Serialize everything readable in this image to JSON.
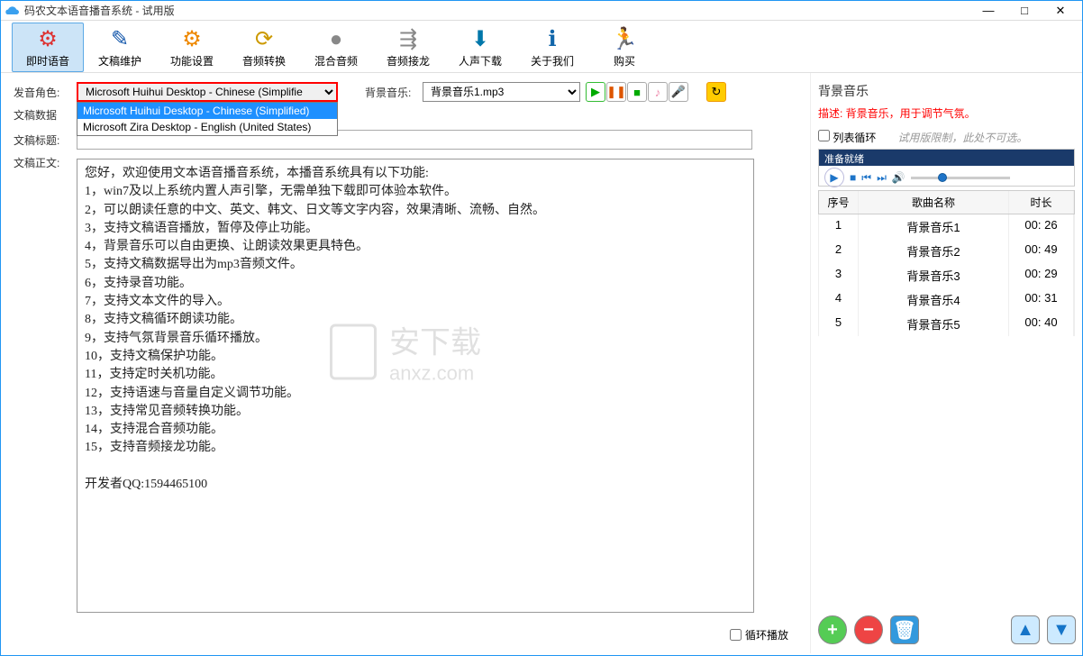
{
  "window": {
    "title": "码农文本语音播音系统 - 试用版"
  },
  "toolbar": {
    "items": [
      {
        "label": "即时语音",
        "icon": "⚙",
        "color": "#d33"
      },
      {
        "label": "文稿维护",
        "icon": "✎",
        "color": "#15a"
      },
      {
        "label": "功能设置",
        "icon": "⚙",
        "color": "#e80"
      },
      {
        "label": "音频转换",
        "icon": "⟳",
        "color": "#c90"
      },
      {
        "label": "混合音频",
        "icon": "●",
        "color": "#888"
      },
      {
        "label": "音频接龙",
        "icon": "⇶",
        "color": "#888"
      },
      {
        "label": "人声下载",
        "icon": "⬇",
        "color": "#07a"
      },
      {
        "label": "关于我们",
        "icon": "ℹ",
        "color": "#16a"
      },
      {
        "label": "购买",
        "icon": "🏃",
        "color": "#07a"
      }
    ]
  },
  "voice": {
    "label": "发音角色:",
    "selected": "Microsoft Huihui Desktop - Chinese (Simplifie",
    "options": [
      "Microsoft Huihui Desktop - Chinese (Simplified)",
      "Microsoft Zira Desktop - English (United States)"
    ]
  },
  "bgm": {
    "label": "背景音乐:",
    "selected": "背景音乐1.mp3"
  },
  "labels": {
    "doc_data": "文稿数据",
    "doc_title": "文稿标题:",
    "doc_body": "文稿正文:",
    "loop": "循环播放"
  },
  "body_text": "您好，欢迎使用文本语音播音系统，本播音系统具有以下功能:\n1，win7及以上系统内置人声引擎，无需单独下载即可体验本软件。\n2，可以朗读任意的中文、英文、韩文、日文等文字内容，效果清晰、流畅、自然。\n3，支持文稿语音播放，暂停及停止功能。\n4，背景音乐可以自由更换、让朗读效果更具特色。\n5，支持文稿数据导出为mp3音频文件。\n6，支持录音功能。\n7，支持文本文件的导入。\n8，支持文稿循环朗读功能。\n9，支持气氛背景音乐循环播放。\n10，支持文稿保护功能。\n11，支持定时关机功能。\n12，支持语速与音量自定义调节功能。\n13，支持常见音频转换功能。\n14，支持混合音频功能。\n15，支持音频接龙功能。\n\n开发者QQ:1594465100",
  "right": {
    "title": "背景音乐",
    "desc": "描述: 背景音乐，用于调节气氛。",
    "loop_list": "列表循环",
    "limit": "试用版限制，此处不可选。",
    "player_status": "准备就绪",
    "cols": {
      "c1": "序号",
      "c2": "歌曲名称",
      "c3": "时长"
    },
    "rows": [
      {
        "n": "1",
        "name": "背景音乐1",
        "dur": "00: 26"
      },
      {
        "n": "2",
        "name": "背景音乐2",
        "dur": "00: 49"
      },
      {
        "n": "3",
        "name": "背景音乐3",
        "dur": "00: 29"
      },
      {
        "n": "4",
        "name": "背景音乐4",
        "dur": "00: 31"
      },
      {
        "n": "5",
        "name": "背景音乐5",
        "dur": "00: 40"
      }
    ]
  },
  "watermark": {
    "text": "安下载",
    "url": "anxz.com"
  }
}
